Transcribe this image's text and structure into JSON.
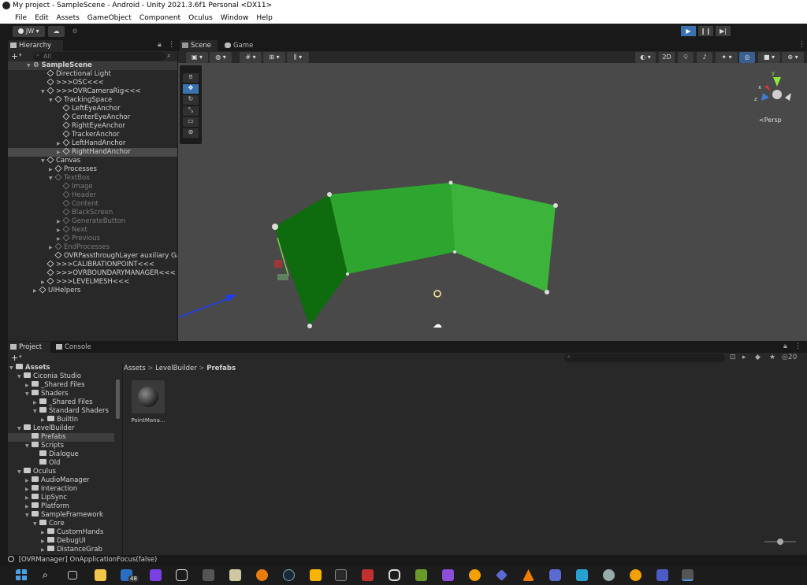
{
  "window": {
    "title": "My project - SampleScene - Android - Unity 2021.3.6f1 Personal <DX11>"
  },
  "menu": [
    "File",
    "Edit",
    "Assets",
    "GameObject",
    "Component",
    "Oculus",
    "Window",
    "Help"
  ],
  "toolbar": {
    "account": "JW",
    "play_icon": "▶",
    "pause_icon": "❙❙",
    "step_icon": "▶|"
  },
  "hierarchy": {
    "tab": "Hierarchy",
    "search_placeholder": "All",
    "add_label": "+",
    "scene": "SampleScene",
    "items": [
      {
        "label": "Directional Light"
      },
      {
        "label": ">>>OSC<<<"
      },
      {
        "label": ">>>OVRCameraRig<<<"
      },
      {
        "label": "TrackingSpace"
      },
      {
        "label": "LeftEyeAnchor"
      },
      {
        "label": "CenterEyeAnchor"
      },
      {
        "label": "RightEyeAnchor"
      },
      {
        "label": "TrackerAnchor"
      },
      {
        "label": "LeftHandAnchor"
      },
      {
        "label": "RightHandAnchor"
      },
      {
        "label": "Canvas"
      },
      {
        "label": "Processes"
      },
      {
        "label": "TextBox"
      },
      {
        "label": "Image"
      },
      {
        "label": "Header"
      },
      {
        "label": "Content"
      },
      {
        "label": "BlackScreen"
      },
      {
        "label": "GenerateButton"
      },
      {
        "label": "Next"
      },
      {
        "label": "Previous"
      },
      {
        "label": "EndProcesses"
      },
      {
        "label": "OVRPassthroughLayer auxiliary GameO"
      },
      {
        "label": ">>>CALIBRATIONPOINT<<<"
      },
      {
        "label": ">>>OVRBOUNDARYMANAGER<<<"
      },
      {
        "label": ">>>LEVELMESH<<<"
      },
      {
        "label": "UIHelpers"
      }
    ]
  },
  "scene_tabs": {
    "scene": "Scene",
    "game": "Game"
  },
  "scene_toolbar": {
    "mode_2d": "2D",
    "gizmo_persp": "<Persp",
    "axis_x": "x",
    "axis_y": "y",
    "axis_z": "z"
  },
  "project": {
    "tab_project": "Project",
    "tab_console": "Console",
    "add_label": "+",
    "hidden_count": "20",
    "breadcrumb": [
      "Assets",
      "LevelBuilder",
      "Prefabs"
    ],
    "tree": [
      {
        "label": "Assets"
      },
      {
        "label": "Ciconia Studio"
      },
      {
        "label": "_Shared Files"
      },
      {
        "label": "Shaders"
      },
      {
        "label": "_Shared Files"
      },
      {
        "label": "Standard Shaders"
      },
      {
        "label": "BuiltIn"
      },
      {
        "label": "LevelBuilder"
      },
      {
        "label": "Prefabs"
      },
      {
        "label": "Scripts"
      },
      {
        "label": "Dialogue"
      },
      {
        "label": "Old"
      },
      {
        "label": "Oculus"
      },
      {
        "label": "AudioManager"
      },
      {
        "label": "Interaction"
      },
      {
        "label": "LipSync"
      },
      {
        "label": "Platform"
      },
      {
        "label": "SampleFramework"
      },
      {
        "label": "Core"
      },
      {
        "label": "CustomHands"
      },
      {
        "label": "DebugUI"
      },
      {
        "label": "DistanceGrab"
      }
    ],
    "assets": [
      {
        "label": "PointMana..."
      }
    ]
  },
  "status": {
    "message": "[OVRManager] OnApplicationFocus(false)"
  },
  "taskbar": {
    "mail_badge": "48"
  },
  "colors": {
    "accent_blue": "#3a72b0",
    "wall_green": "#3cb43c",
    "wall_dark_green": "#0e6c0e",
    "scene_bg": "#494949"
  }
}
